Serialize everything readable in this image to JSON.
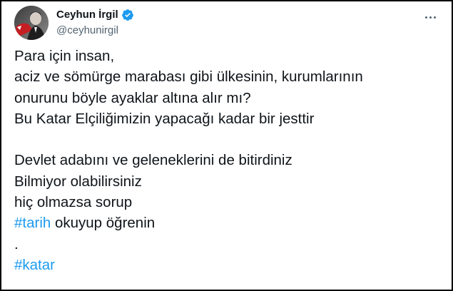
{
  "author": {
    "display_name": "Ceyhun İrgil",
    "handle": "@ceyhunirgil",
    "verified": true,
    "avatar_icon": "profile-avatar"
  },
  "menu": {
    "icon": "more-horizontal-icon"
  },
  "tweet": {
    "line1": "Para için insan,",
    "line2": "aciz ve sömürge marabası gibi ülkesinin, kurumlarının",
    "line3": "onurunu böyle ayaklar altına alır mı?",
    "line4": "Bu Katar Elçiliğimizin yapacağı kadar bir jesttir",
    "line5": "Devlet adabını ve geleneklerini de bitirdiniz",
    "line6": "Bilmiyor olabilirsiniz",
    "line7": "hiç olmazsa sorup",
    "line8_hashtag": "#tarih",
    "line8_rest": " okuyup öğrenin",
    "line9": ".",
    "line10_hashtag": "#katar"
  },
  "colors": {
    "text": "#0f1419",
    "secondary": "#536471",
    "link": "#1d9bf0",
    "verified": "#1d9bf0",
    "frame": "#000000"
  }
}
